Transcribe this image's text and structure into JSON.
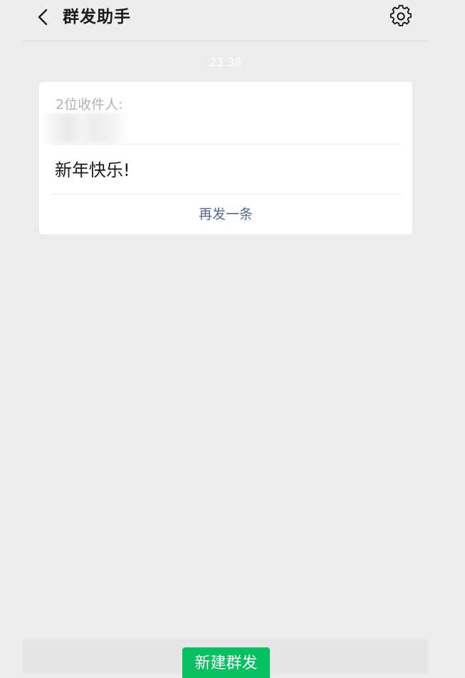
{
  "header": {
    "title": "群发助手",
    "back_icon": "chevron-left-icon",
    "settings_icon": "gear-icon"
  },
  "chat": {
    "timestamp": "23:38"
  },
  "card": {
    "recipients_label": "2位收件人:",
    "message": "新年快乐!",
    "resend_label": "再发一条"
  },
  "footer": {
    "new_broadcast_label": "新建群发"
  },
  "colors": {
    "accent_green": "#07c160",
    "link_blue": "#576b95",
    "background": "#ededed"
  }
}
